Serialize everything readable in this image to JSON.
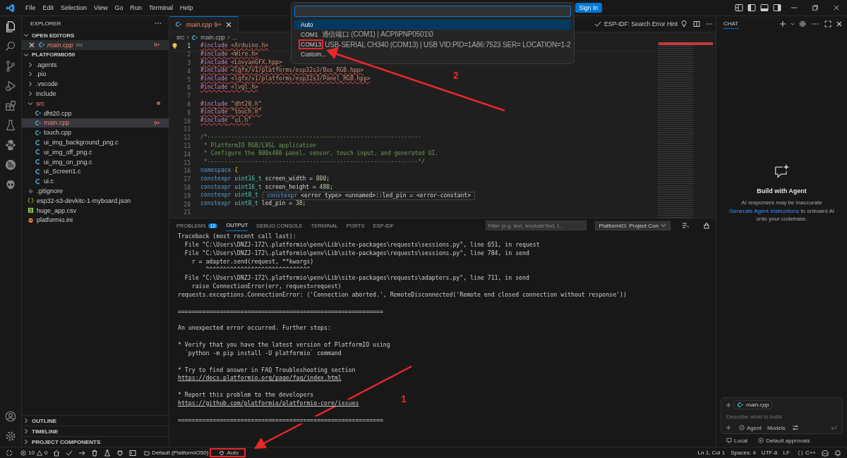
{
  "menu": [
    "File",
    "Edit",
    "Selection",
    "View",
    "Go",
    "Run",
    "Terminal",
    "Help"
  ],
  "sign_in": "Sign In",
  "quick_pick": {
    "items": [
      {
        "label": "Auto",
        "selected": true,
        "marked": false
      },
      {
        "label": "COM1",
        "detail": "通信端口 (COM1) | ACPI\\PNP0501\\0",
        "selected": false,
        "marked": false
      },
      {
        "label": "COM13",
        "detail": "USB-SERIAL CH340 (COM13) | USB VID:PID=1A86:7523 SER= LOCATION=1-2",
        "selected": false,
        "marked": true
      },
      {
        "label": "Custom...",
        "selected": false,
        "marked": false
      }
    ]
  },
  "explorer": {
    "title": "EXPLORER",
    "open_editors": {
      "label": "OPEN EDITORS",
      "expanded": true,
      "items": [
        {
          "name": "main.cpp",
          "folder": "src",
          "badge": "9+",
          "error": true
        }
      ]
    },
    "project": {
      "label": "PLATFORMIO50",
      "expanded": true,
      "children": [
        {
          "name": ".agents",
          "kind": "folder",
          "expanded": false,
          "selected": false,
          "error": false
        },
        {
          "name": ".pio",
          "kind": "folder",
          "expanded": false,
          "selected": false,
          "error": false
        },
        {
          "name": ".vscode",
          "kind": "folder",
          "expanded": false,
          "selected": false,
          "error": false
        },
        {
          "name": "include",
          "kind": "folder",
          "expanded": false,
          "selected": false,
          "error": false
        },
        {
          "name": "src",
          "kind": "folder",
          "expanded": true,
          "selected": false,
          "error": true,
          "children": [
            {
              "name": "dht20.cpp",
              "kind": "cpp",
              "selected": false,
              "error": false
            },
            {
              "name": "main.cpp",
              "kind": "cpp",
              "selected": true,
              "error": true,
              "badge": "9+"
            },
            {
              "name": "touch.cpp",
              "kind": "cpp",
              "selected": false,
              "error": false
            },
            {
              "name": "ui_img_background_png.c",
              "kind": "c",
              "selected": false,
              "error": false
            },
            {
              "name": "ui_img_off_png.c",
              "kind": "c",
              "selected": false,
              "error": false
            },
            {
              "name": "ui_img_on_png.c",
              "kind": "c",
              "selected": false,
              "error": false
            },
            {
              "name": "ui_Screen1.c",
              "kind": "c",
              "selected": false,
              "error": false
            },
            {
              "name": "ui.c",
              "kind": "c",
              "selected": false,
              "error": false
            }
          ]
        },
        {
          "name": ".gitignore",
          "kind": "gitignore",
          "selected": false,
          "error": false
        },
        {
          "name": "esp32-s3-devkitc-1-myboard.json",
          "kind": "json",
          "selected": false,
          "error": false
        },
        {
          "name": "huge_app.csv",
          "kind": "csv",
          "selected": false,
          "error": false
        },
        {
          "name": "platformio.ini",
          "kind": "ini",
          "selected": false,
          "error": false
        }
      ]
    },
    "sections": [
      {
        "label": "OUTLINE",
        "expanded": false
      },
      {
        "label": "TIMELINE",
        "expanded": false
      },
      {
        "label": "PROJECT COMPONENTS",
        "expanded": false
      }
    ]
  },
  "editor": {
    "tabs": [
      {
        "label": "main.cpp",
        "badge": "9+",
        "selected": true,
        "error": true
      }
    ],
    "toolbar_label": "ESP-IDF: Search Error Hint",
    "breadcrumbs": [
      "src",
      "main.cpp",
      "..."
    ],
    "lines": [
      {
        "num": "1",
        "error": true,
        "tokens": [
          {
            "text": "#include",
            "kind": "dir"
          },
          {
            "text": " <Arduino.h>",
            "kind": "str"
          }
        ]
      },
      {
        "num": "2",
        "error": true,
        "tokens": [
          {
            "text": "#include",
            "kind": "dir"
          },
          {
            "text": " <Wire.h>",
            "kind": "str"
          }
        ]
      },
      {
        "num": "3",
        "error": true,
        "tokens": [
          {
            "text": "#include",
            "kind": "dir"
          },
          {
            "text": " <LovyanGFX.hpp>",
            "kind": "str"
          }
        ]
      },
      {
        "num": "4",
        "error": true,
        "tokens": [
          {
            "text": "#include",
            "kind": "dir"
          },
          {
            "text": " <lgfx/v1/platforms/esp32s3/Bus_RGB.hpp>",
            "kind": "str"
          }
        ]
      },
      {
        "num": "5",
        "error": true,
        "tokens": [
          {
            "text": "#include",
            "kind": "dir"
          },
          {
            "text": " <lgfx/v1/platforms/esp32s3/Panel_RGB.hpp>",
            "kind": "str"
          }
        ]
      },
      {
        "num": "6",
        "error": true,
        "tokens": [
          {
            "text": "#include",
            "kind": "dir"
          },
          {
            "text": " <lvgl.h>",
            "kind": "str"
          }
        ]
      },
      {
        "num": "7"
      },
      {
        "num": "8",
        "error": true,
        "tokens": [
          {
            "text": "#include",
            "kind": "dir"
          },
          {
            "text": " \"dht20.h\"",
            "kind": "str"
          }
        ]
      },
      {
        "num": "9",
        "error": true,
        "tokens": [
          {
            "text": "#include",
            "kind": "dir"
          },
          {
            "text": " \"touch.h\"",
            "kind": "str"
          }
        ]
      },
      {
        "num": "10",
        "error": true,
        "tokens": [
          {
            "text": "#include",
            "kind": "dir"
          },
          {
            "text": " \"ui.h\"",
            "kind": "str"
          }
        ]
      },
      {
        "num": "11"
      },
      {
        "num": "12",
        "error": false,
        "tokens": [
          {
            "text": "/*---------------------------------------------------------------",
            "kind": "cm"
          }
        ]
      },
      {
        "num": "13",
        "error": false,
        "tokens": [
          {
            "text": " * PlatformIO RGB/LVGL application",
            "kind": "cm"
          }
        ]
      },
      {
        "num": "14",
        "error": false,
        "tokens": [
          {
            "text": " * Configure the 800x480 panel, sensor, touch input, and generated UI.",
            "kind": "cm"
          }
        ]
      },
      {
        "num": "15",
        "error": false,
        "tokens": [
          {
            "text": " *--------------------------------------------------------------*/",
            "kind": "cm"
          }
        ]
      },
      {
        "num": "16",
        "error": false,
        "tokens": [
          {
            "text": "namespace",
            "kind": "kw"
          },
          {
            "text": " {",
            "kind": "brace"
          }
        ]
      },
      {
        "num": "17",
        "error": false,
        "tokens": [
          {
            "text": "constexpr",
            "kind": "kw"
          },
          {
            "text": " uint16_t",
            "kind": "type"
          },
          {
            "text": " screen_width = ",
            "kind": "pl"
          },
          {
            "text": "800",
            "kind": "num"
          },
          {
            "text": ";",
            "kind": "pl"
          }
        ]
      },
      {
        "num": "18",
        "error": false,
        "tokens": [
          {
            "text": "constexpr",
            "kind": "kw"
          },
          {
            "text": " uint16_t",
            "kind": "type"
          },
          {
            "text": " screen_height = ",
            "kind": "pl"
          },
          {
            "text": "480",
            "kind": "num"
          },
          {
            "text": ";",
            "kind": "pl"
          }
        ]
      },
      {
        "num": "19",
        "error": false,
        "tokens": [
          {
            "text": "constexpr",
            "kind": "kw"
          },
          {
            "text": " uint8_t",
            "kind": "type"
          }
        ],
        "hover": [
          {
            "text": "constexpr",
            "kind": "kw"
          },
          {
            "text": " <error type> <unnamed>::led_pin = <error-constant>",
            "kind": "pl"
          }
        ]
      },
      {
        "num": "20",
        "error": false,
        "tokens": [
          {
            "text": "constexpr",
            "kind": "kw"
          },
          {
            "text": " uint8_t",
            "kind": "type"
          },
          {
            "text": " led_pin = ",
            "kind": "pl"
          },
          {
            "text": "38",
            "kind": "num"
          },
          {
            "text": ";",
            "kind": "pl"
          }
        ]
      },
      {
        "num": "21"
      }
    ]
  },
  "panel": {
    "tabs": [
      {
        "label": "PROBLEMS",
        "badge": "10",
        "selected": false
      },
      {
        "label": "OUTPUT",
        "selected": true
      },
      {
        "label": "DEBUG CONSOLE",
        "selected": false
      },
      {
        "label": "TERMINAL",
        "selected": false
      },
      {
        "label": "PORTS",
        "selected": false
      },
      {
        "label": "ESP-IDF",
        "selected": false
      }
    ],
    "filter_placeholder": "Filter (e.g. text, !excludeText, t...",
    "channel": "PlatformIO: Project Con",
    "output": [
      {
        "kind": "text",
        "text": "Traceback (most recent call last):"
      },
      {
        "kind": "text",
        "text": "  File \"C:\\Users\\DNZJ-172\\.platformio\\penv\\Lib\\site-packages\\requests\\sessions.py\", line 651, in request"
      },
      {
        "kind": "text",
        "text": "  File \"C:\\Users\\DNZJ-172\\.platformio\\penv\\Lib\\site-packages\\requests\\sessions.py\", line 784, in send"
      },
      {
        "kind": "text",
        "text": "    r = adapter.send(request, **kwargs)"
      },
      {
        "kind": "text",
        "text": "        ^^^^^^^^^^^^^^^^^^^^^^^^^^^^^^"
      },
      {
        "kind": "text",
        "text": "  File \"C:\\Users\\DNZJ-172\\.platformio\\penv\\Lib\\site-packages\\requests\\adapters.py\", line 711, in send"
      },
      {
        "kind": "text",
        "text": "    raise ConnectionError(err, request=request)"
      },
      {
        "kind": "text",
        "text": "requests.exceptions.ConnectionError: ('Connection aborted.', RemoteDisconnected('Remote end closed connection without response'))"
      },
      {
        "kind": "blank"
      },
      {
        "kind": "text",
        "text": "==========================================================="
      },
      {
        "kind": "blank"
      },
      {
        "kind": "text",
        "text": "An unexpected error occurred. Further steps:"
      },
      {
        "kind": "blank"
      },
      {
        "kind": "text",
        "text": "* Verify that you have the latest version of PlatformIO using"
      },
      {
        "kind": "text",
        "text": "  `python -m pip install -U platformio` command"
      },
      {
        "kind": "blank"
      },
      {
        "kind": "text",
        "text": "* Try to find answer in FAQ Troubleshooting section"
      },
      {
        "kind": "link",
        "text": "https://docs.platformio.org/page/faq/index.html"
      },
      {
        "kind": "blank"
      },
      {
        "kind": "text",
        "text": "* Report this problem to the developers"
      },
      {
        "kind": "link",
        "text": "https://github.com/platformio/platformio-core/issues"
      },
      {
        "kind": "blank"
      },
      {
        "kind": "text",
        "text": "==========================================================="
      }
    ]
  },
  "chat": {
    "tab": "CHAT",
    "heading": "Build with Agent",
    "note": "AI responses may be inaccurate",
    "link": "Generate Agent Instructions",
    "after_link": " to onboard AI onto your codebase.",
    "context_file": "main.cpp",
    "placeholder": "Describe what to build",
    "mode": "Agent",
    "models": "Models",
    "location": "Local",
    "approvals": "Default approvals"
  },
  "status_bar": {
    "errors": "10",
    "warnings": "0",
    "environment": "Default (PlatformIO50)",
    "port": {
      "text": "Auto",
      "marked": true
    },
    "right": [
      "Ln 1, Col 1",
      "Spaces: 4",
      "UTF-8",
      "LF"
    ],
    "language": "C++"
  },
  "annotations": [
    {
      "label": "1"
    },
    {
      "label": "2"
    }
  ]
}
